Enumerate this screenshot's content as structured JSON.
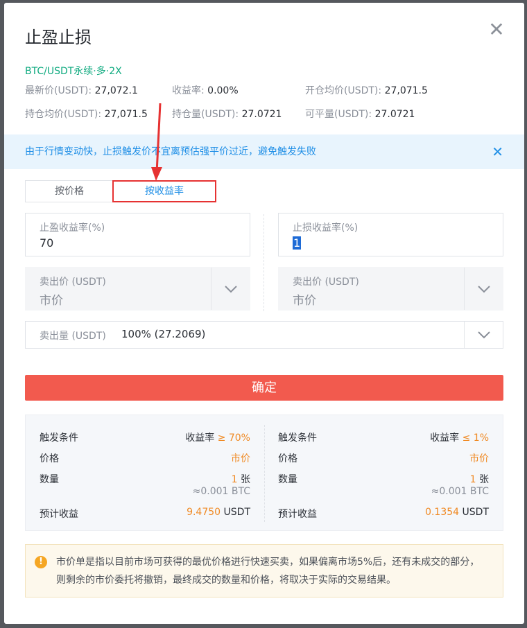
{
  "modal": {
    "title": "止盈止损",
    "close_glyph": "✕"
  },
  "pair": "BTC/USDT永续·多·2X",
  "info": [
    {
      "label": "最新价(USDT): ",
      "value": "27,072.1"
    },
    {
      "label": "收益率: ",
      "value": "0.00%"
    },
    {
      "label": "开仓均价(USDT): ",
      "value": "27,071.5"
    },
    {
      "label": "持仓均价(USDT): ",
      "value": "27,071.5"
    },
    {
      "label": "持仓量(USDT): ",
      "value": "27.0721"
    },
    {
      "label": "可平量(USDT): ",
      "value": "27.0721"
    }
  ],
  "banner": {
    "text": "由于行情变动快，止损触发价不宜离预估强平价过近，避免触发失败",
    "close_glyph": "✕"
  },
  "tabs": [
    {
      "label": "按价格"
    },
    {
      "label": "按收益率"
    }
  ],
  "take_profit": {
    "label": "止盈收益率(%)",
    "value": "70"
  },
  "stop_loss": {
    "label": "止损收益率(%)",
    "value": "1"
  },
  "tp_sell": {
    "label": "卖出价 (USDT)",
    "value": "市价"
  },
  "sl_sell": {
    "label": "卖出价 (USDT)",
    "value": "市价"
  },
  "quantity": {
    "label": "卖出量 (USDT)",
    "value": "100% (27.2069)"
  },
  "confirm_label": "确定",
  "summary": {
    "left": {
      "trigger_label": "触发条件",
      "trigger_prefix": "收益率 ",
      "trigger_value": "≥ 70%",
      "price_label": "价格",
      "price_value": "市价",
      "qty_label": "数量",
      "qty_value": "1",
      "qty_unit": " 张",
      "qty_btc": "≈0.001 BTC",
      "profit_label": "预计收益",
      "profit_value": "9.4750",
      "profit_unit": " USDT"
    },
    "right": {
      "trigger_label": "触发条件",
      "trigger_prefix": "收益率 ",
      "trigger_value": "≤ 1%",
      "price_label": "价格",
      "price_value": "市价",
      "qty_label": "数量",
      "qty_value": "1",
      "qty_unit": " 张",
      "qty_btc": "≈0.001 BTC",
      "profit_label": "预计收益",
      "profit_value": "0.1354",
      "profit_unit": " USDT"
    }
  },
  "notice": {
    "icon_glyph": "!",
    "text": "市价单是指以目前市场可获得的最优价格进行快速买卖，如果偏离市场5%后，还有未成交的部分，则剩余的市价委托将撤销，最终成交的数量和价格，将取决于实际的交易结果。"
  },
  "colors": {
    "accent": "#1e8ee6",
    "confirm": "#f25a4e",
    "profit": "#f08a24",
    "pair": "#0eaa7f",
    "annotation": "#e63232"
  }
}
